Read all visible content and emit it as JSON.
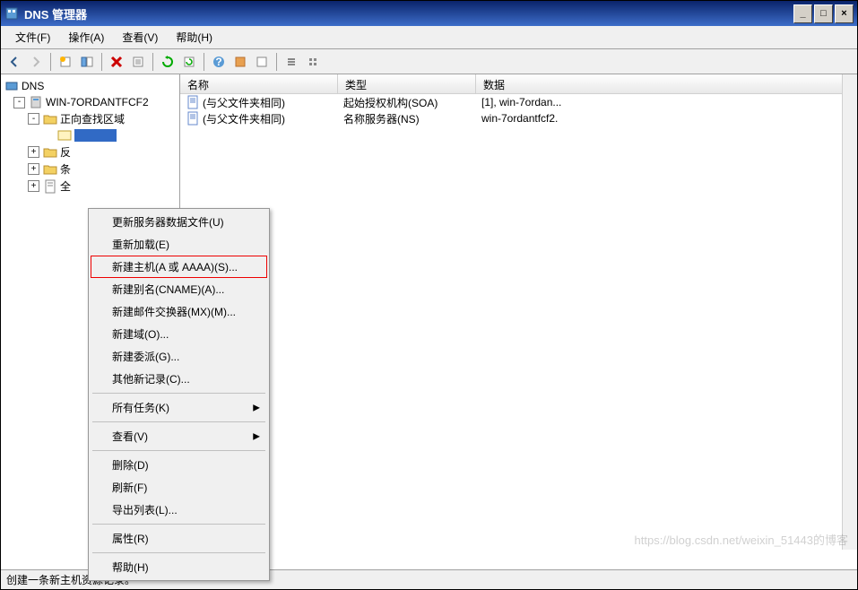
{
  "title": "DNS 管理器",
  "menubar": [
    "文件(F)",
    "操作(A)",
    "查看(V)",
    "帮助(H)"
  ],
  "tree": {
    "root": "DNS",
    "server": "WIN-7ORDANTFCF2",
    "forward_zone": "正向查找区域",
    "other": [
      "反",
      "条",
      "全"
    ],
    "toggle_minus": "-",
    "toggle_plus": "+"
  },
  "list": {
    "headers": [
      "名称",
      "类型",
      "数据"
    ],
    "rows": [
      {
        "name": "(与父文件夹相同)",
        "type": "起始授权机构(SOA)",
        "data": "[1], win-7ordan..."
      },
      {
        "name": "(与父文件夹相同)",
        "type": "名称服务器(NS)",
        "data": "win-7ordantfcf2."
      }
    ]
  },
  "context_menu": [
    {
      "label": "更新服务器数据文件(U)"
    },
    {
      "label": "重新加载(E)"
    },
    {
      "label": "新建主机(A 或 AAAA)(S)...",
      "highlighted": true
    },
    {
      "label": "新建别名(CNAME)(A)..."
    },
    {
      "label": "新建邮件交换器(MX)(M)..."
    },
    {
      "label": "新建域(O)..."
    },
    {
      "label": "新建委派(G)..."
    },
    {
      "label": "其他新记录(C)..."
    },
    {
      "sep": true
    },
    {
      "label": "所有任务(K)",
      "submenu": true
    },
    {
      "sep": true
    },
    {
      "label": "查看(V)",
      "submenu": true
    },
    {
      "sep": true
    },
    {
      "label": "删除(D)"
    },
    {
      "label": "刷新(F)"
    },
    {
      "label": "导出列表(L)..."
    },
    {
      "sep": true
    },
    {
      "label": "属性(R)"
    },
    {
      "sep": true
    },
    {
      "label": "帮助(H)"
    }
  ],
  "statusbar": "创建一条新主机资源记录。",
  "watermark": "https://blog.csdn.net/weixin_51443的博客",
  "submenu_arrow": "▶",
  "titlebar_icons": {
    "min": "_",
    "max": "□",
    "close": "×"
  }
}
